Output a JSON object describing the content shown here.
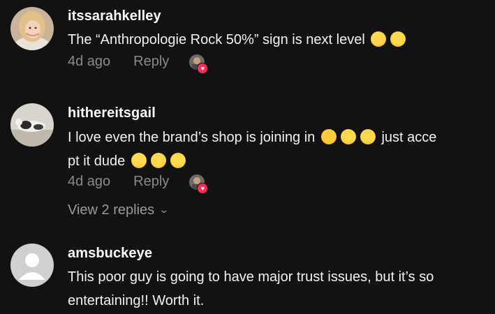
{
  "comments": [
    {
      "username": "itssarahkelley",
      "text": "The “Anthropologie Rock 50%” sign is next level",
      "time": "4d ago",
      "reply_label": "Reply"
    },
    {
      "username": "hithereitsgail",
      "text_line1": "I love even the brand’s shop is joining in",
      "text_line1_tail": "just acce",
      "text_line2": "pt it dude",
      "time": "4d ago",
      "reply_label": "Reply",
      "view_replies": "View 2 replies"
    },
    {
      "username": "amsbuckeye",
      "text": "This poor guy is going to have major trust issues, but it’s so entertaining!! Worth it."
    }
  ],
  "colors": {
    "background": "#121212",
    "meta": "#8a8a8a",
    "like_badge": "#fe2c55"
  }
}
